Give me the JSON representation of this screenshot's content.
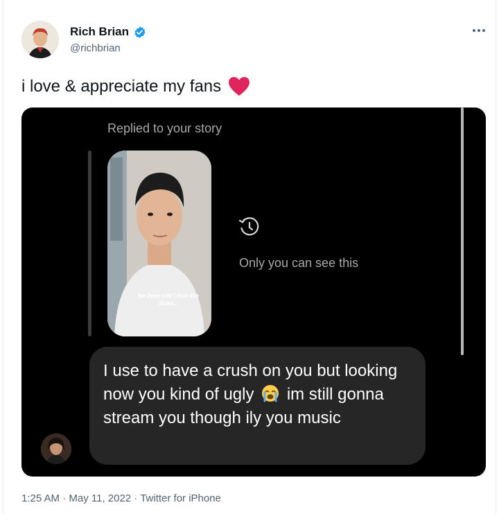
{
  "user": {
    "display_name": "Rich Brian",
    "handle": "@richbrian",
    "verified": true
  },
  "tweet": {
    "text": "i love & appreciate my fans",
    "emoji": "red-heart"
  },
  "media": {
    "replied_label": "Replied to your story",
    "story_caption": "Ive been told I look like drake...",
    "privacy_note": "Only you can see this",
    "message_part1": "I use to have a crush on you but looking now you kind of ugly",
    "message_emoji": "loudly-crying-face",
    "message_part2": "im still gonna stream you though ily you music"
  },
  "footer": {
    "meta": "1:25 AM · May 11, 2022 · Twitter for iPhone"
  },
  "colors": {
    "verified_blue": "#1d9bf0",
    "heart_red": "#e0245e",
    "bubble_bg": "#262626"
  }
}
